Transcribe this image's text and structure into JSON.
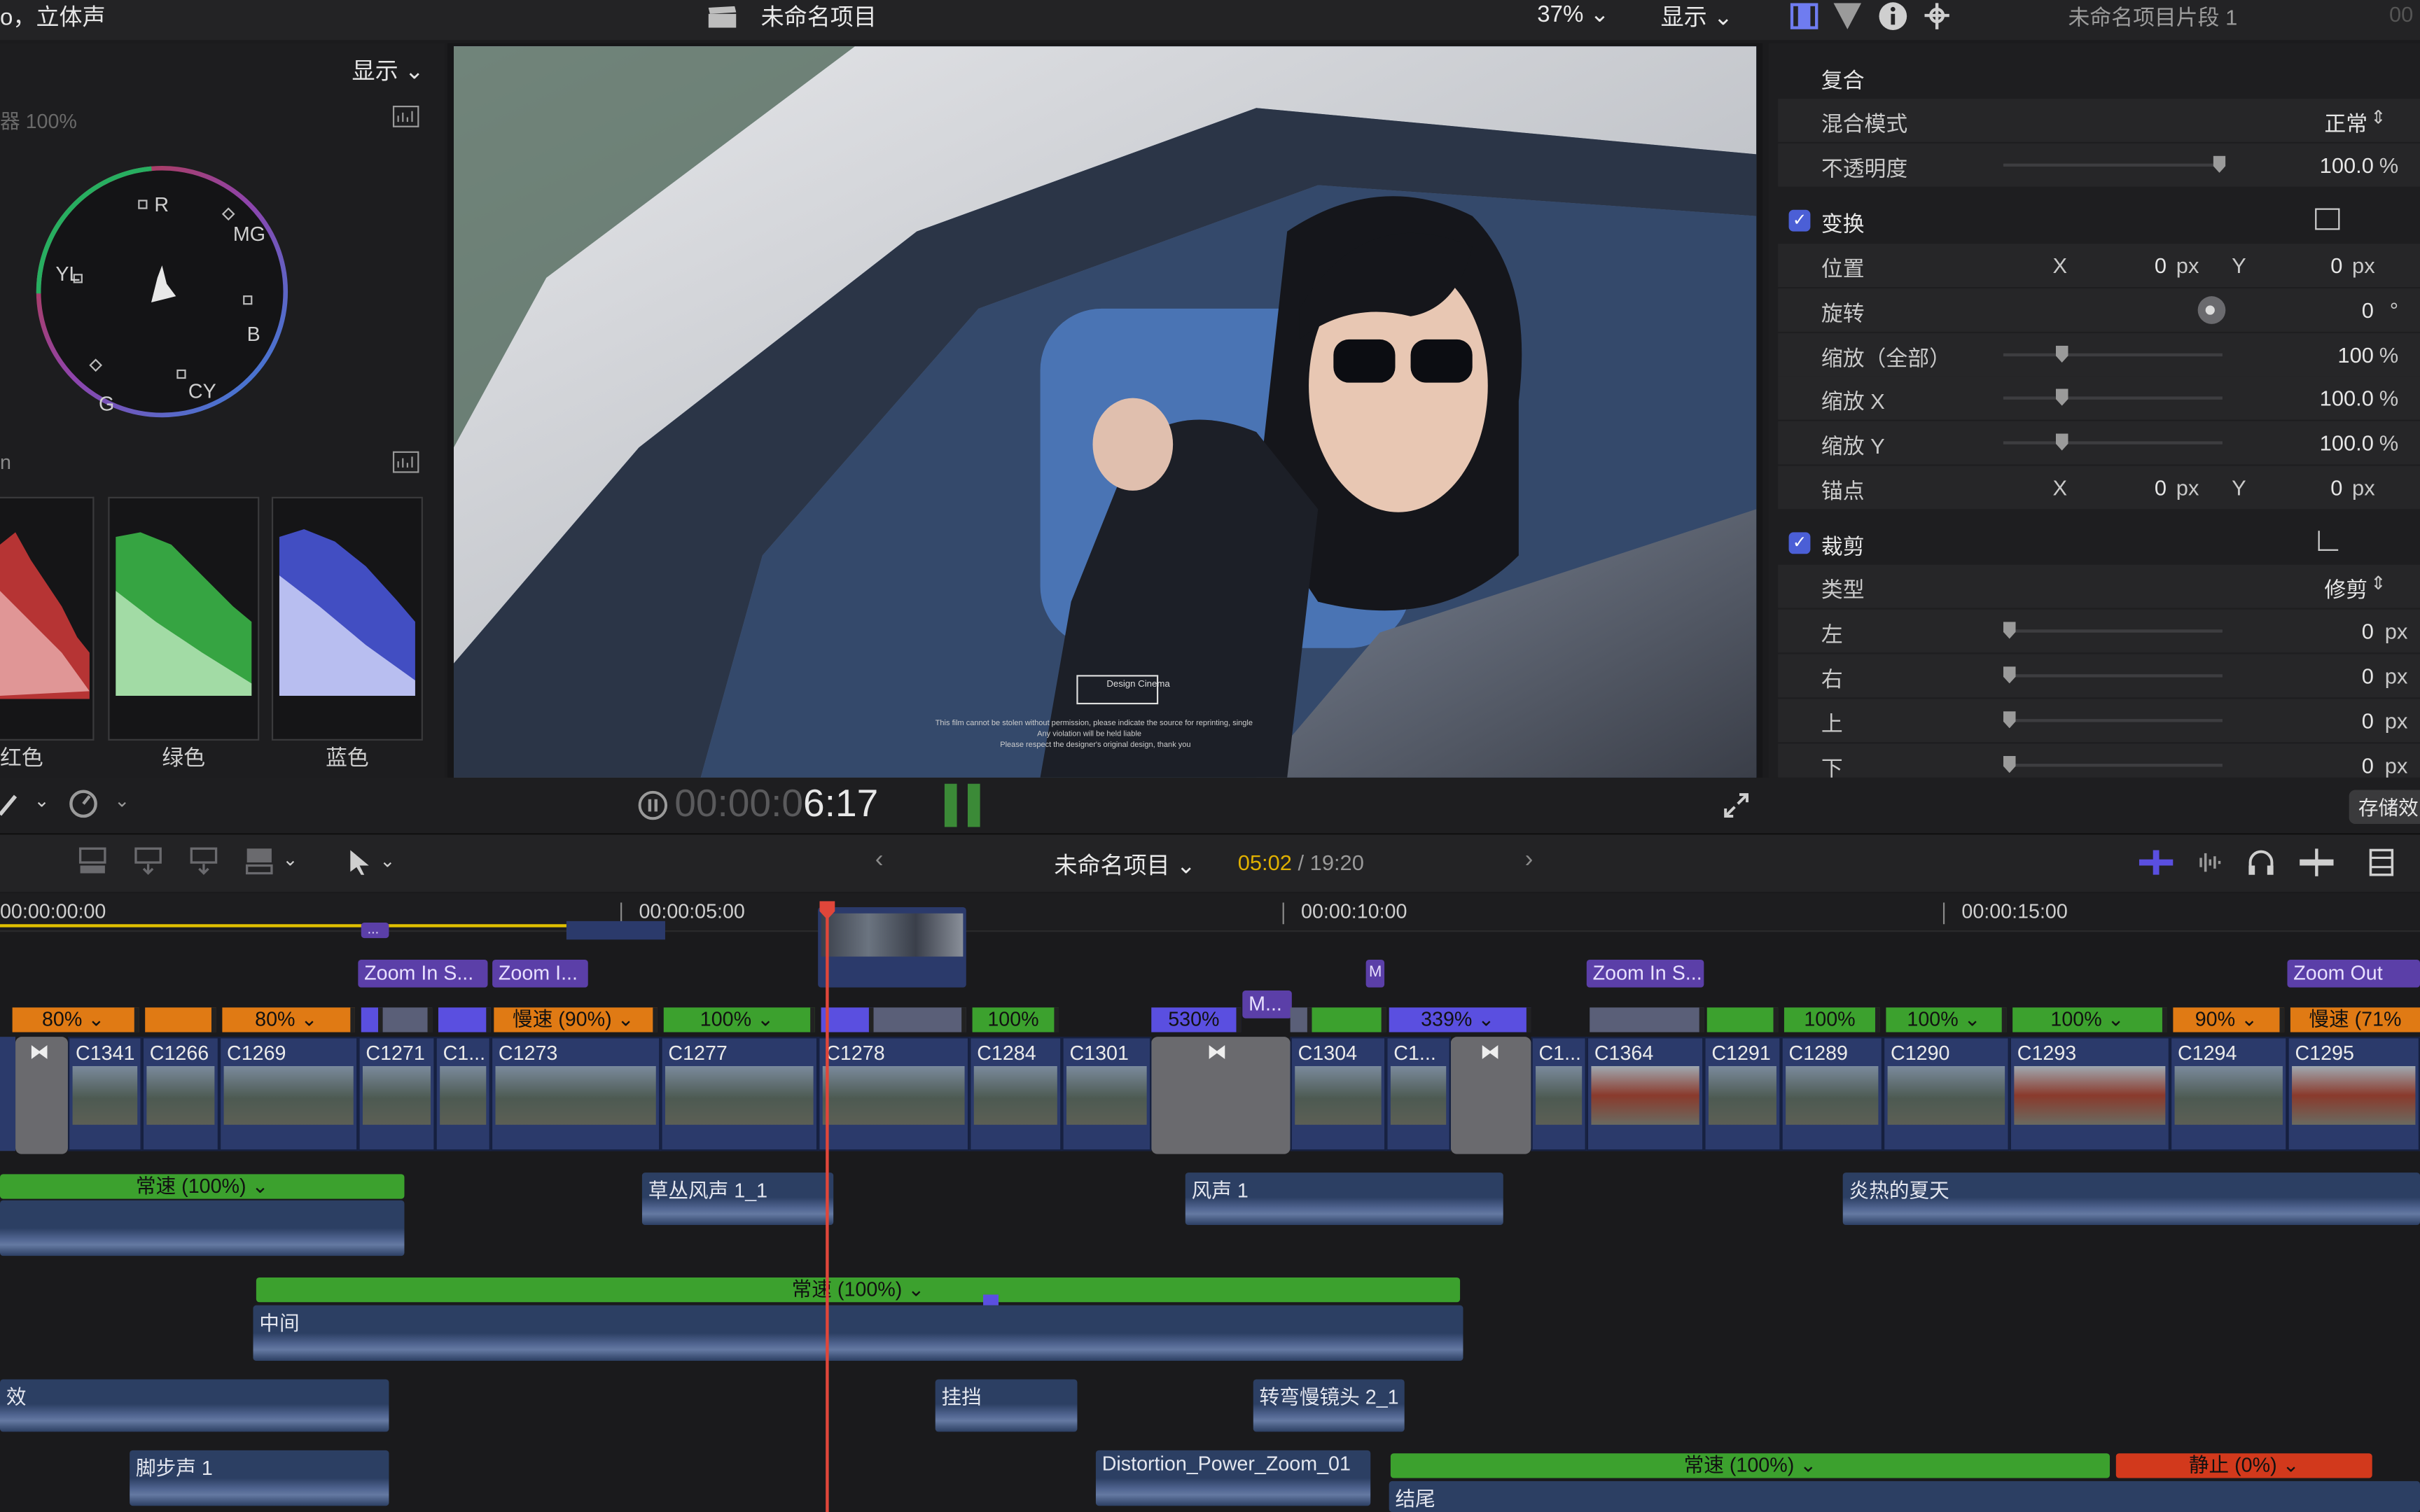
{
  "top_bar": {
    "left_info": "o，立体声",
    "project_title": "未命名项目",
    "zoom": "37%",
    "display_label": "显示",
    "clip_name": "未命名项目片段 1",
    "clip_time_partial": "00"
  },
  "scopes": {
    "display_label": "显示",
    "vectorscope_label": "器 100%",
    "vector_targets": [
      "R",
      "MG",
      "B",
      "CY",
      "G",
      "YL"
    ],
    "parade_label": "n",
    "channels": [
      "红色",
      "绿色",
      "蓝色"
    ]
  },
  "viewer": {
    "logo_text": "Design Cinema",
    "fine_print": [
      "This film cannot be stolen without permission, please indicate the source for reprinting, single",
      "Any violation will be held liable",
      "Please respect the designer's original design, thank you"
    ]
  },
  "inspector": {
    "composite_header": "复合",
    "blend_mode_label": "混合模式",
    "blend_mode_value": "正常",
    "opacity_label": "不透明度",
    "opacity_value": "100.0",
    "opacity_unit": "%",
    "transform_header": "变换",
    "position_label": "位置",
    "pos_x_label": "X",
    "pos_x_value": "0",
    "pos_y_label": "Y",
    "pos_y_value": "0",
    "px_unit": "px",
    "rotation_label": "旋转",
    "rotation_value": "0",
    "rotation_unit": "°",
    "scale_all_label": "缩放（全部）",
    "scale_all_value": "100",
    "scale_x_label": "缩放 X",
    "scale_x_value": "100.0",
    "scale_y_label": "缩放 Y",
    "scale_y_value": "100.0",
    "anchor_label": "锚点",
    "anchor_x_value": "0",
    "anchor_y_value": "0",
    "crop_header": "裁剪",
    "type_label": "类型",
    "type_value": "修剪",
    "left_label": "左",
    "right_label": "右",
    "top_label": "上",
    "bottom_label": "下",
    "crop_value": "0",
    "save_button": "存储效"
  },
  "transport": {
    "timecode_dim": "00:00:0",
    "timecode_bright": "6:17"
  },
  "timeline_toolbar": {
    "project_name": "未命名项目",
    "current_time": "05:02",
    "total_time": "/ 19:20"
  },
  "ruler": [
    "00:00:00:00",
    "00:00:05:00",
    "00:00:10:00",
    "00:00:15:00"
  ],
  "titles": [
    "...",
    "Zoom In S...",
    "Zoom I...",
    "M...",
    "Zoom In S...",
    "Zoom Out Smo",
    "M"
  ],
  "speed_bars": [
    "80%",
    "80%",
    "慢速 (90%)",
    "100%",
    "100%",
    "530%",
    "339%",
    "100%",
    "100%",
    "100%",
    "90%",
    "慢速 (71%"
  ],
  "clips": [
    "C1341",
    "C1266",
    "C1269",
    "C1271",
    "C1...",
    "C1273",
    "C1277",
    "C1278",
    "C1284",
    "C1301",
    "C1304",
    "C1...",
    "C1...",
    "C1364",
    "C1291",
    "C1289",
    "C1290",
    "C1293",
    "C1294",
    "C1295"
  ],
  "audio": {
    "normal_speed_1": "常速 (100%)",
    "cao": "草丛风声 1_1",
    "feng": "风声 1",
    "summer": "炎热的夏天",
    "normal_speed_2": "常速 (100%)",
    "middle": "中间",
    "effect": "效",
    "guadang": "挂挡",
    "turn": "转弯慢镜头 2_1",
    "footsteps": "脚步声 1",
    "distortion": "Distortion_Power_Zoom_01",
    "normal_speed_3": "常速 (100%)",
    "still": "静止 (0%)",
    "ending": "结尾"
  },
  "colors": {
    "accent": "#5a4fe0",
    "playhead": "#e0463a",
    "speed_green": "#3ca12e",
    "speed_orange": "#e07a14",
    "title_purple": "#5b3fa8"
  }
}
